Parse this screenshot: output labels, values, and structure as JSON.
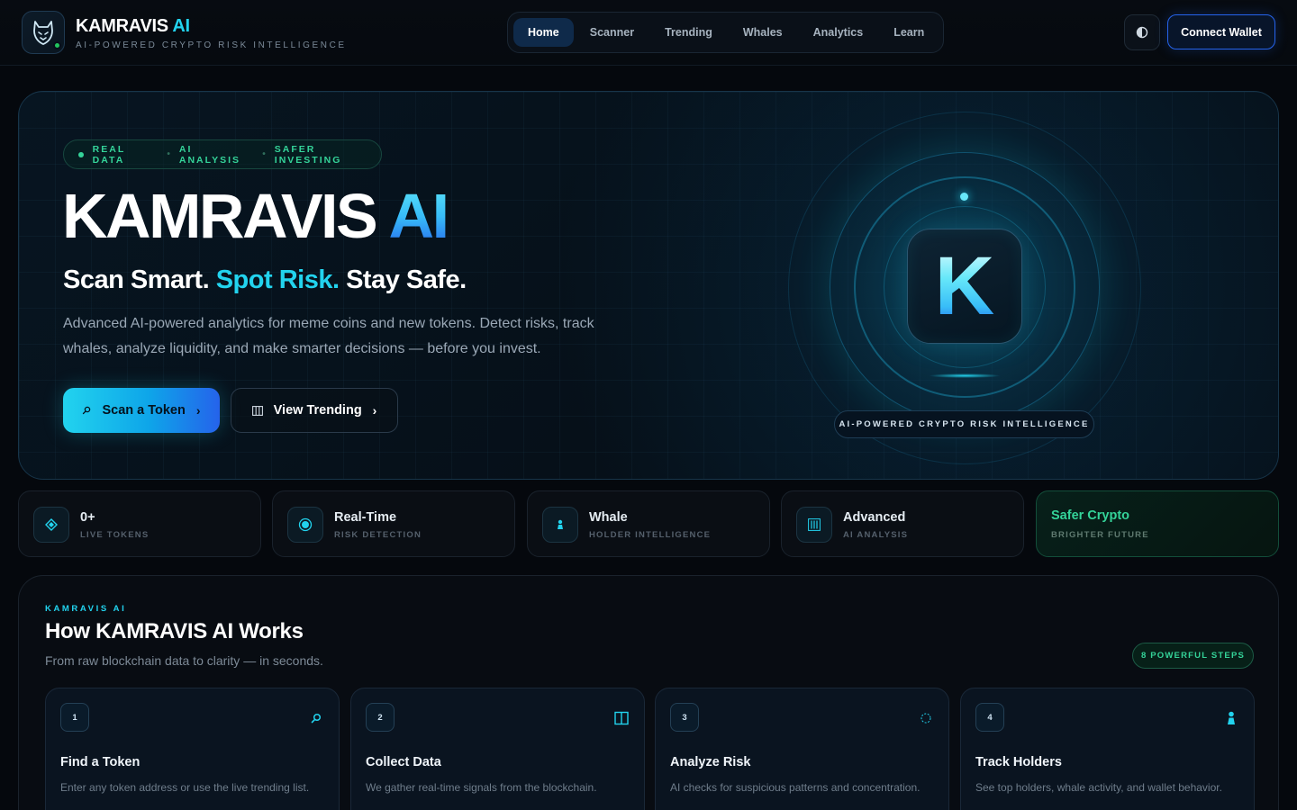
{
  "header": {
    "brand_name": "KAMRAVIS",
    "brand_ai": "AI",
    "brand_subtitle": "AI-POWERED CRYPTO RISK INTELLIGENCE",
    "nav": [
      {
        "label": "Home",
        "active": true
      },
      {
        "label": "Scanner",
        "active": false
      },
      {
        "label": "Trending",
        "active": false
      },
      {
        "label": "Whales",
        "active": false
      },
      {
        "label": "Analytics",
        "active": false
      },
      {
        "label": "Learn",
        "active": false
      }
    ],
    "connect_label": "Connect Wallet"
  },
  "hero": {
    "pill": [
      "REAL DATA",
      "AI ANALYSIS",
      "SAFER INVESTING"
    ],
    "title": "KAMRAVIS",
    "title_ai": "AI",
    "tagline_1": "Scan Smart.",
    "tagline_2": "Spot Risk.",
    "tagline_3": "Stay Safe.",
    "description": "Advanced AI-powered analytics for meme coins and new tokens. Detect risks, track whales, analyze liquidity, and make smarter decisions — before you invest.",
    "primary_button": "Scan a Token",
    "secondary_button": "View Trending",
    "emblem_letter": "K",
    "emblem_label": "AI-POWERED CRYPTO RISK INTELLIGENCE"
  },
  "stats": [
    {
      "value": "0+",
      "label": "LIVE TOKENS",
      "icon": "diamond-icon"
    },
    {
      "value": "Real-Time",
      "label": "RISK DETECTION",
      "icon": "target-icon"
    },
    {
      "value": "Whale",
      "label": "HOLDER INTELLIGENCE",
      "icon": "person-icon"
    },
    {
      "value": "Advanced",
      "label": "AI ANALYSIS",
      "icon": "bars-icon"
    },
    {
      "value": "Safer Crypto",
      "label": "BRIGHTER FUTURE"
    }
  ],
  "how": {
    "eyebrow": "KAMRAVIS AI",
    "title": "How KAMRAVIS AI Works",
    "subtitle": "From raw blockchain data to clarity — in seconds.",
    "steps_badge": "8 POWERFUL STEPS",
    "steps": [
      {
        "num": "1",
        "title": "Find a Token",
        "desc": "Enter any token address or use the live trending list.",
        "icon": "search-icon"
      },
      {
        "num": "2",
        "title": "Collect Data",
        "desc": "We gather real-time signals from the blockchain.",
        "icon": "columns-icon"
      },
      {
        "num": "3",
        "title": "Analyze Risk",
        "desc": "AI checks for suspicious patterns and concentration.",
        "icon": "spinner-icon"
      },
      {
        "num": "4",
        "title": "Track Holders",
        "desc": "See top holders, whale activity, and wallet behavior.",
        "icon": "person-icon"
      }
    ]
  },
  "colors": {
    "accent": "#22d3ee",
    "accent_blue": "#2563eb",
    "success": "#34d399",
    "background": "#05080d"
  }
}
